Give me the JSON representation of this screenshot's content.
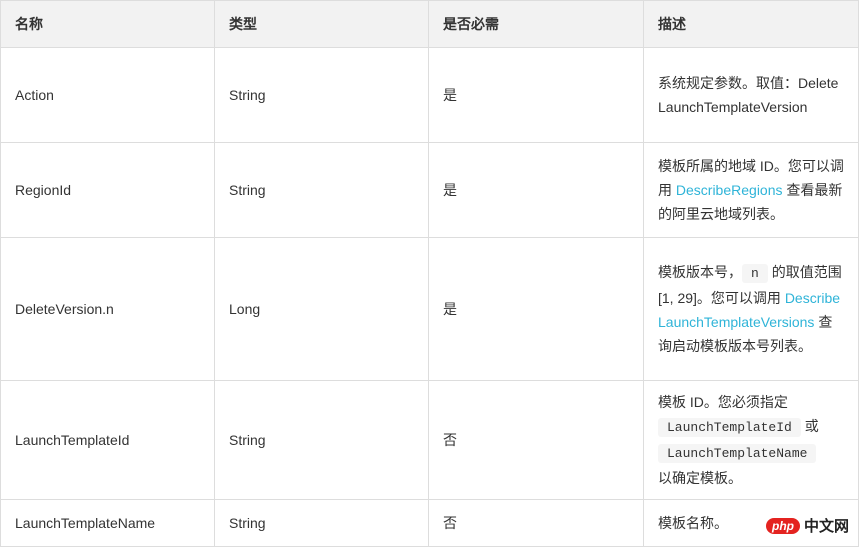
{
  "table": {
    "headers": [
      "名称",
      "类型",
      "是否必需",
      "描述"
    ],
    "rows": [
      {
        "name": "Action",
        "type": "String",
        "required": "是",
        "description": {
          "text_1": "系统规定参数。取值：DeleteLaunchTemplateVersion"
        }
      },
      {
        "name": "RegionId",
        "type": "String",
        "required": "是",
        "description": {
          "text_1": "模板所属的地域 ID。您可以调用 ",
          "link_1": "DescribeRegions",
          "text_2": " 查看最新的阿里云地域列表。"
        }
      },
      {
        "name": "DeleteVersion.n",
        "type": "Long",
        "required": "是",
        "description": {
          "text_1": "模板版本号，",
          "code_1": "n",
          "text_2": " 的取值范围 [1, 29]。您可以调用 ",
          "link_1": "DescribeLaunchTemplateVersions",
          "text_3": " 查询启动模板版本号列表。"
        }
      },
      {
        "name": "LaunchTemplateId",
        "type": "String",
        "required": "否",
        "description": {
          "text_1": "模板 ID。您必须指定 ",
          "code_1": "LaunchTemplateId",
          "text_2": " 或 ",
          "code_2": "LaunchTemplateName",
          "text_3": " 以确定模板。"
        }
      },
      {
        "name": "LaunchTemplateName",
        "type": "String",
        "required": "否",
        "description": {
          "text_1": "模板名称。"
        }
      }
    ]
  },
  "watermark": {
    "logo": "php",
    "text": "中文网"
  },
  "colors": {
    "link": "#2fb4d8",
    "header_bg": "#f2f2f2",
    "border": "#dddddd"
  }
}
